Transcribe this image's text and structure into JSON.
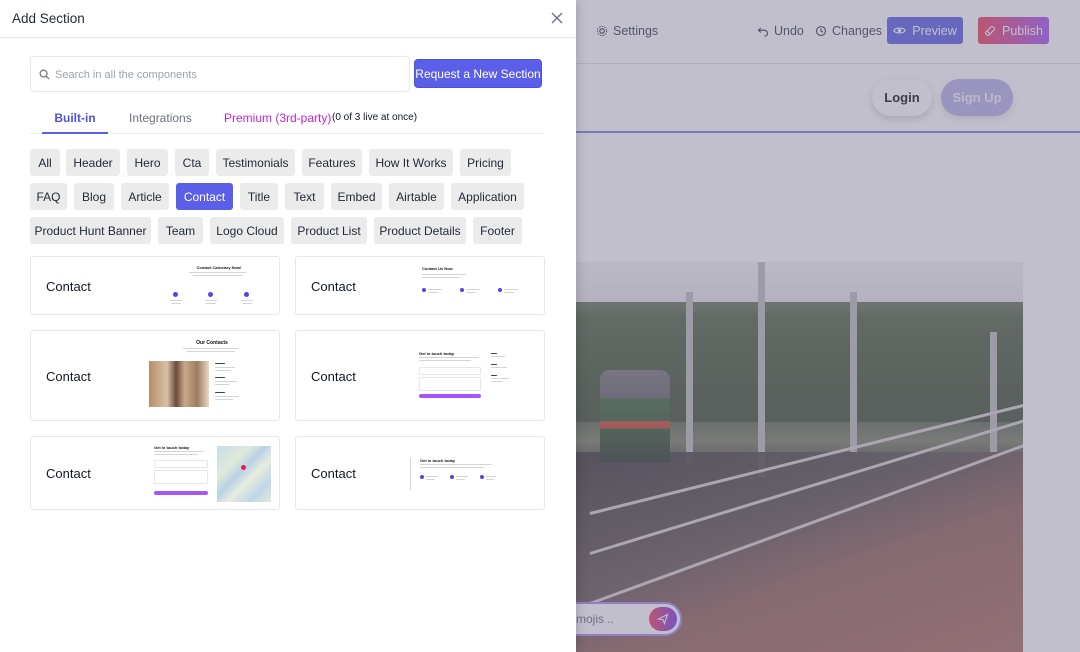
{
  "panel": {
    "title": "Add Section",
    "search_placeholder": "Search in all the components",
    "request_button": "Request a New Section"
  },
  "tabs": [
    {
      "label": "Built-in"
    },
    {
      "label": "Integrations"
    },
    {
      "label": "Premium (3rd-party)"
    }
  ],
  "premium_note": "(0 of 3 live at once)",
  "categories": [
    "All",
    "Header",
    "Hero",
    "Cta",
    "Testimonials",
    "Features",
    "How It Works",
    "Pricing",
    "FAQ",
    "Blog",
    "Article",
    "Contact",
    "Title",
    "Text",
    "Embed",
    "Airtable",
    "Application",
    "Product Hunt Banner",
    "Team",
    "Logo Cloud",
    "Product List",
    "Product Details",
    "Footer"
  ],
  "selected_category": "Contact",
  "cards": [
    {
      "label": "Contact",
      "preview_title": "Contact Calculary Now!"
    },
    {
      "label": "Contact",
      "preview_title": "Contact Us Now"
    },
    {
      "label": "Contact",
      "preview_title": "Our Contacts"
    },
    {
      "label": "Contact",
      "preview_title": "Get in touch today"
    },
    {
      "label": "Contact",
      "preview_title": "Get in touch today"
    },
    {
      "label": "Contact",
      "preview_title": "Get in touch today"
    }
  ],
  "background": {
    "settings": "Settings",
    "undo": "Undo",
    "changes": "Changes",
    "preview": "Preview",
    "publish": "Publish",
    "login": "Login",
    "signup": "Sign Up",
    "chat_placeholder": "mojis .."
  },
  "colors": {
    "accent": "#5b5fe8",
    "premium": "#c026d3",
    "chip_bg": "#ebebeb"
  }
}
